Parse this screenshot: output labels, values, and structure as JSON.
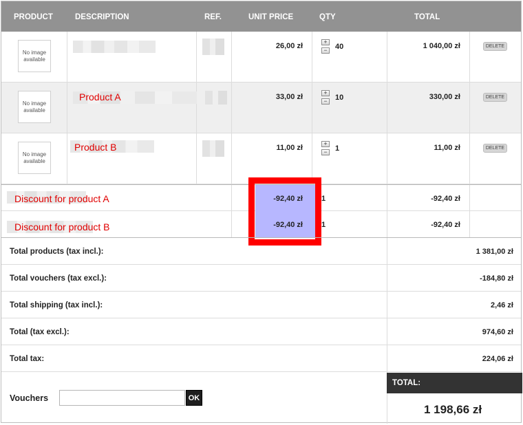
{
  "header": {
    "product": "PRODUCT",
    "description": "DESCRIPTION",
    "ref": "REF.",
    "unit_price": "UNIT PRICE",
    "qty": "QTY",
    "total": "TOTAL"
  },
  "products": [
    {
      "image": "No image available",
      "name": "",
      "unit_price": "26,00 zł",
      "qty": "40",
      "total": "1 040,00 zł",
      "delete": "DELETE"
    },
    {
      "image": "No image available",
      "name": "Product A",
      "unit_price": "33,00 zł",
      "qty": "10",
      "total": "330,00 zł",
      "delete": "DELETE"
    },
    {
      "image": "No image available",
      "name": "Product B",
      "unit_price": "11,00 zł",
      "qty": "1",
      "total": "11,00 zł",
      "delete": "DELETE"
    }
  ],
  "discounts": [
    {
      "name": "Discount for product A",
      "unit_price": "-92,40 zł",
      "qty": "1",
      "total": "-92,40 zł"
    },
    {
      "name": "Discount for product B",
      "unit_price": "-92,40 zł",
      "qty": "1",
      "total": "-92,40 zł"
    }
  ],
  "totals": {
    "products_label": "Total products (tax incl.):",
    "products_value": "1 381,00 zł",
    "vouchers_label": "Total vouchers (tax excl.):",
    "vouchers_value": "-184,80 zł",
    "shipping_label": "Total shipping (tax incl.):",
    "shipping_value": "2,46 zł",
    "excl_label": "Total (tax excl.):",
    "excl_value": "974,60 zł",
    "tax_label": "Total tax:",
    "tax_value": "224,06 zł"
  },
  "voucher": {
    "label": "Vouchers",
    "input_value": "",
    "ok": "OK"
  },
  "grand_total": {
    "label": "TOTAL:",
    "value": "1 198,66 zł"
  },
  "colors": {
    "header_bg": "#929292",
    "highlight": "#b7b7ff",
    "annotation": "#ff0000",
    "total_bar": "#333333"
  }
}
